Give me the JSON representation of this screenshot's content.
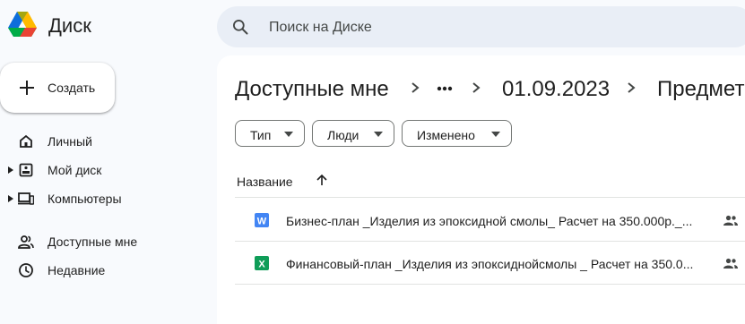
{
  "app": {
    "title": "Диск",
    "brand_colors": [
      "#0066da",
      "#00ac47",
      "#ffba00",
      "#ea4335"
    ]
  },
  "search": {
    "placeholder": "Поиск на Диске",
    "icon": "search-icon"
  },
  "sidebar": {
    "create_label": "Создать",
    "items": [
      {
        "label": "Личный",
        "icon": "home-icon",
        "expandable": false
      },
      {
        "label": "Мой диск",
        "icon": "drive-icon",
        "expandable": true
      },
      {
        "label": "Компьютеры",
        "icon": "computers-icon",
        "expandable": true
      },
      {
        "label": "Доступные мне",
        "icon": "shared-people-icon",
        "expandable": false
      },
      {
        "label": "Недавние",
        "icon": "clock-icon",
        "expandable": false
      }
    ]
  },
  "breadcrumb": {
    "items": [
      "Доступные мне",
      "01.09.2023",
      "Предмет"
    ],
    "more_icon": "more-horizontal-icon"
  },
  "filters": [
    {
      "label": "Тип"
    },
    {
      "label": "Люди"
    },
    {
      "label": "Изменено"
    }
  ],
  "table": {
    "column_name": "Название",
    "sort": "ascending",
    "rows": [
      {
        "name": "Бизнес-план _Изделия из эпоксидной смолы_ Расчет на 350.000р._...",
        "type": "docx",
        "type_letter": "W",
        "color": "#4285f4",
        "shared": true
      },
      {
        "name": "Финансовый-план  _Изделия из эпоксиднойсмолы _ Расчет на 350.0...",
        "type": "xlsx",
        "type_letter": "X",
        "color": "#0f9d58",
        "shared": true
      }
    ]
  }
}
